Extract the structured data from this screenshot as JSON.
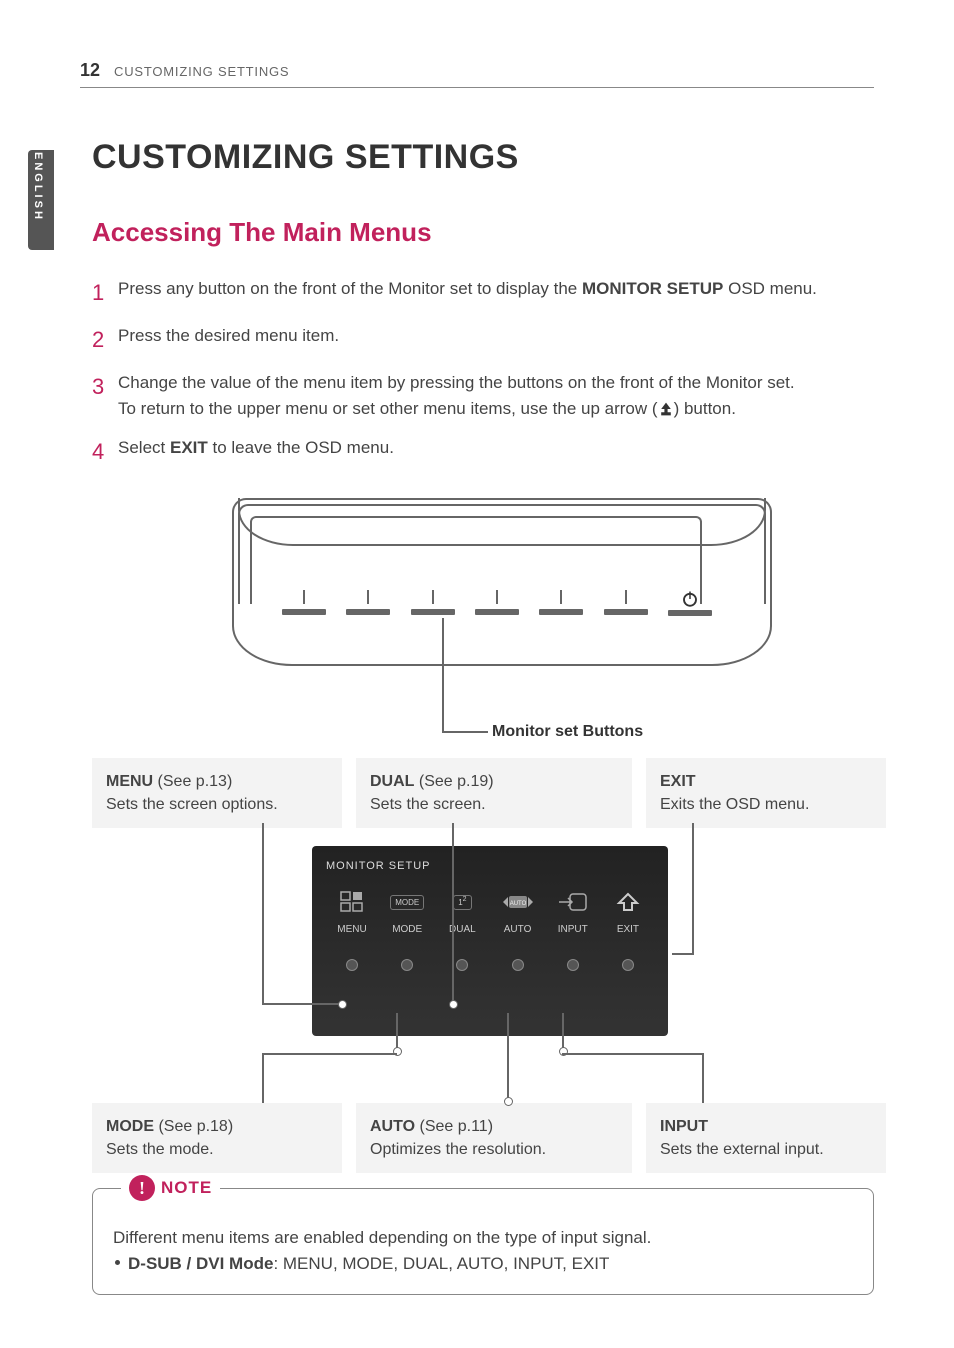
{
  "header": {
    "page_number": "12",
    "running_title": "CUSTOMIZING SETTINGS"
  },
  "language_tab": "ENGLISH",
  "title": "CUSTOMIZING SETTINGS",
  "subtitle": "Accessing The Main Menus",
  "steps": [
    {
      "num": "1",
      "pre": "Press any button on the front of the Monitor set to display the ",
      "bold": "MONITOR SETUP",
      "post": " OSD menu."
    },
    {
      "num": "2",
      "pre": "Press the desired menu item.",
      "bold": "",
      "post": ""
    },
    {
      "num": "3",
      "pre": "Change the value of the menu item by pressing the buttons on the front of the Monitor set.\nTo return to the upper menu or set other menu items, use the up arrow (",
      "bold": "",
      "post": ") button.",
      "has_icon": true
    },
    {
      "num": "4",
      "pre": "Select ",
      "bold": "EXIT",
      "post": " to leave the OSD menu."
    }
  ],
  "diagram": {
    "buttons_caption": "Monitor set Buttons",
    "osd_title": "MONITOR SETUP",
    "osd_labels": [
      "MENU",
      "MODE",
      "DUAL",
      "AUTO",
      "INPUT",
      "EXIT"
    ],
    "osd_icon_mode": "MODE",
    "osd_icon_dual_1": "1",
    "osd_icon_dual_2": "2",
    "osd_icon_auto": "AUTO"
  },
  "descriptions": {
    "menu": {
      "label": "MENU",
      "ref": " (See p.13)",
      "text": "Sets the screen options."
    },
    "dual": {
      "label": "DUAL",
      "ref": " (See p.19)",
      "text": "Sets the screen."
    },
    "exit": {
      "label": "EXIT",
      "ref": "",
      "text": "Exits the OSD menu."
    },
    "mode": {
      "label": "MODE",
      "ref": " (See p.18)",
      "text": "Sets the mode."
    },
    "auto": {
      "label": "AUTO",
      "ref": " (See p.11)",
      "text": "Optimizes the resolution."
    },
    "input": {
      "label": "INPUT",
      "ref": "",
      "text": "Sets the external input."
    }
  },
  "note": {
    "heading": "NOTE",
    "line1": "Different menu items are enabled depending on the type of input signal.",
    "bullet_bold": "D-SUB / DVI Mode",
    "bullet_rest": ": MENU, MODE, DUAL, AUTO, INPUT, EXIT"
  }
}
